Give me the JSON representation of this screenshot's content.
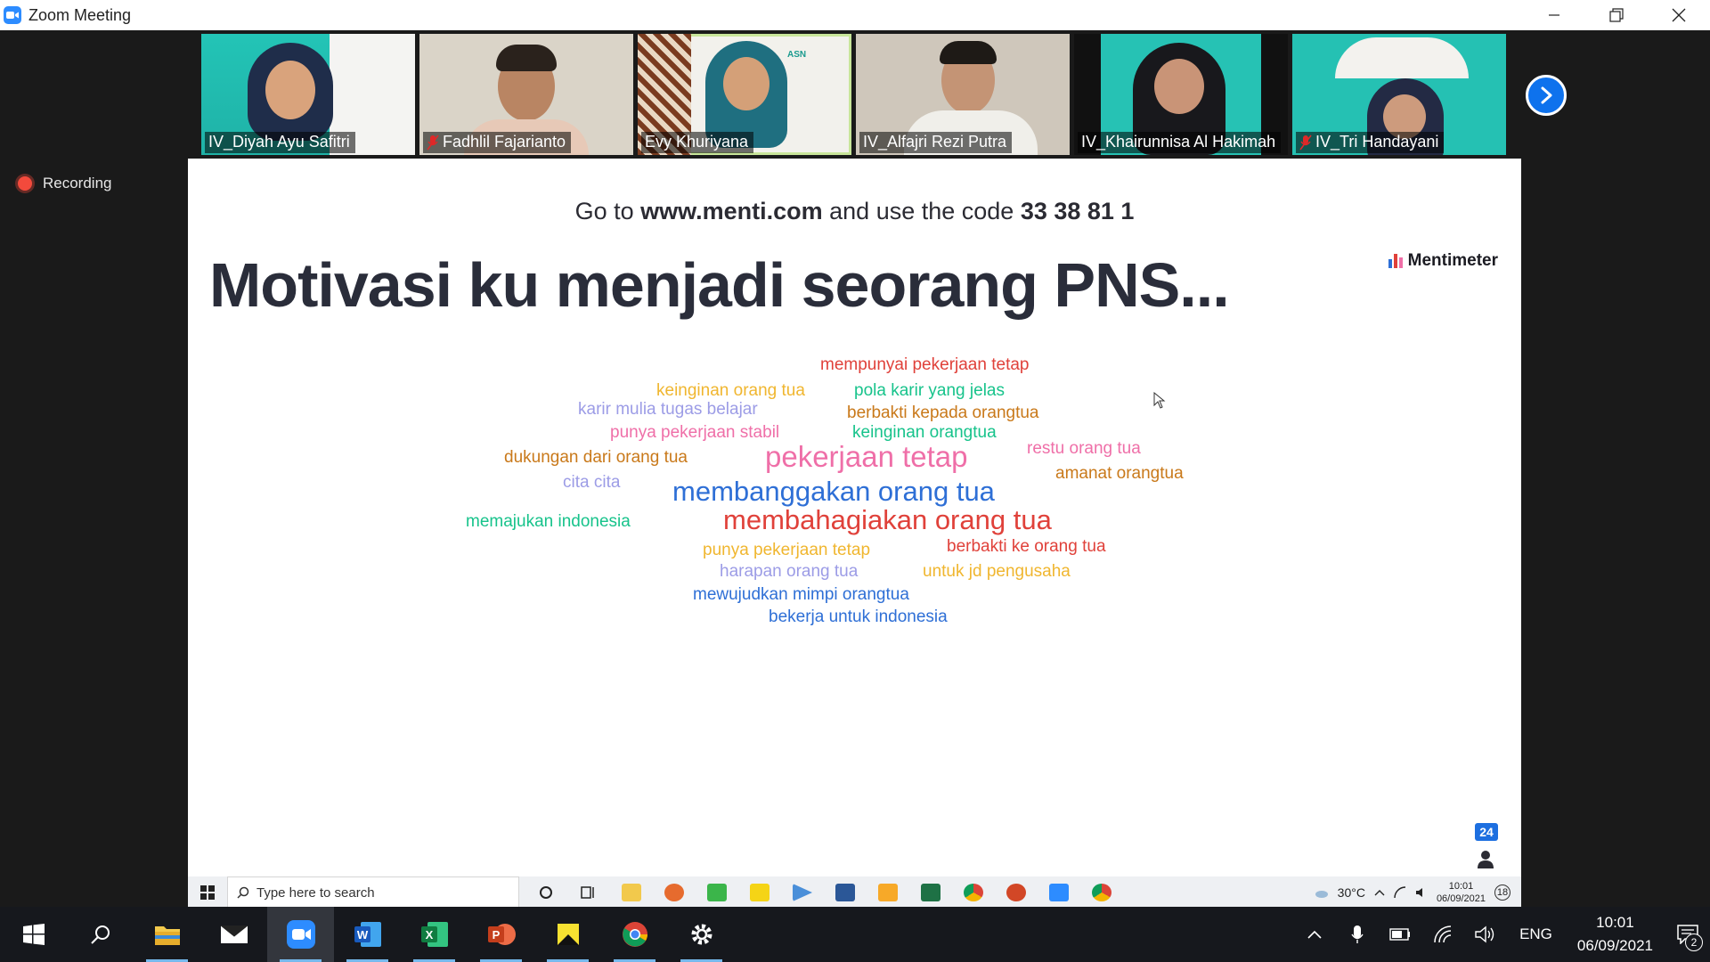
{
  "window": {
    "title": "Zoom Meeting",
    "minimize_icon": "minimize-icon",
    "restore_icon": "restore-icon",
    "close_icon": "close-icon"
  },
  "participants": [
    {
      "name": "IV_Diyah Ayu Safitri",
      "muted": false,
      "active": false
    },
    {
      "name": "Fadhlil Fajarianto",
      "muted": true,
      "active": false
    },
    {
      "name": "Evy Khuriyana",
      "muted": false,
      "active": true
    },
    {
      "name": "IV_Alfajri Rezi Putra",
      "muted": false,
      "active": false
    },
    {
      "name": "IV_Khairunnisa Al Hakimah",
      "muted": false,
      "active": false
    },
    {
      "name": "IV_Tri Handayani",
      "muted": true,
      "active": false
    }
  ],
  "recording": {
    "label": "Recording"
  },
  "slide": {
    "code_prefix": "Go to ",
    "code_site": "www.menti.com",
    "code_middle": " and use the code ",
    "code_value": "33 38 81 1",
    "title": "Motivasi ku menjadi seorang PNS...",
    "brand": "Mentimeter",
    "participant_count": "24",
    "words": [
      {
        "text": "mempunyai pekerjaan tetap",
        "color": "#e0413a"
      },
      {
        "text": "keinginan orang tua",
        "color": "#f0b62f"
      },
      {
        "text": "pola karir yang jelas",
        "color": "#17c38b"
      },
      {
        "text": "karir mulia tugas belajar",
        "color": "#9c9ce6"
      },
      {
        "text": "berbakti kepada orangtua",
        "color": "#c9791a"
      },
      {
        "text": "punya pekerjaan stabil",
        "color": "#ef6fa8"
      },
      {
        "text": "keinginan orangtua",
        "color": "#17c38b"
      },
      {
        "text": "dukungan dari orang tua",
        "color": "#c9791a"
      },
      {
        "text": "pekerjaan tetap",
        "color": "#ef6fa8"
      },
      {
        "text": "restu orang tua",
        "color": "#ef6fa8"
      },
      {
        "text": "amanat orangtua",
        "color": "#c9791a"
      },
      {
        "text": "cita cita",
        "color": "#9c9ce6"
      },
      {
        "text": "membanggakan orang tua",
        "color": "#2e6fd6"
      },
      {
        "text": "memajukan indonesia",
        "color": "#17c38b"
      },
      {
        "text": "membahagiakan orang tua",
        "color": "#e0413a"
      },
      {
        "text": "punya pekerjaan tetap",
        "color": "#f0b62f"
      },
      {
        "text": "berbakti ke orang tua",
        "color": "#e0413a"
      },
      {
        "text": "harapan orang tua",
        "color": "#9c9ce6"
      },
      {
        "text": "untuk jd pengusaha",
        "color": "#f0b62f"
      },
      {
        "text": "mewujudkan mimpi orangtua",
        "color": "#2e6fd6"
      },
      {
        "text": "bekerja untuk indonesia",
        "color": "#2e6fd6"
      }
    ]
  },
  "inner_taskbar": {
    "search_placeholder": "Type here to search",
    "weather": "30°C",
    "time": "10:01",
    "date": "06/09/2021",
    "notification_count": "18"
  },
  "taskbar": {
    "apps": [
      "windows-start-icon",
      "search-icon",
      "file-explorer-icon",
      "mail-icon",
      "zoom-icon",
      "word-icon",
      "excel-icon",
      "powerpoint-icon",
      "sticky-notes-icon",
      "chrome-icon",
      "settings-icon"
    ],
    "language": "ENG",
    "time": "10:01",
    "date": "06/09/2021",
    "notification_count": "2"
  }
}
